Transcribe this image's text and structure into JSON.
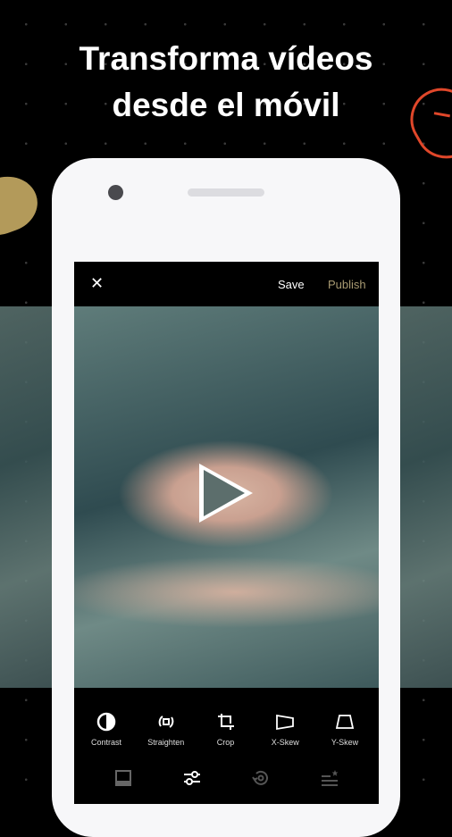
{
  "headline": {
    "line1": "Transforma vídeos",
    "line2": "desde el móvil"
  },
  "topbar": {
    "close_icon": "close-icon",
    "save": "Save",
    "publish": "Publish"
  },
  "tools": [
    {
      "label": "Contrast",
      "icon": "contrast-icon"
    },
    {
      "label": "Straighten",
      "icon": "straighten-icon"
    },
    {
      "label": "Crop",
      "icon": "crop-icon"
    },
    {
      "label": "X-Skew",
      "icon": "x-skew-icon"
    },
    {
      "label": "Y-Skew",
      "icon": "y-skew-icon"
    }
  ],
  "bottom_nav": [
    {
      "icon": "presets-icon",
      "active": false
    },
    {
      "icon": "adjust-sliders-icon",
      "active": true
    },
    {
      "icon": "history-icon",
      "active": false
    },
    {
      "icon": "recipes-icon",
      "active": false
    }
  ],
  "colors": {
    "background": "#000000",
    "accent_publish": "#a89a72",
    "gold_blob": "#b39a5a",
    "red_ring": "#e0472a"
  }
}
